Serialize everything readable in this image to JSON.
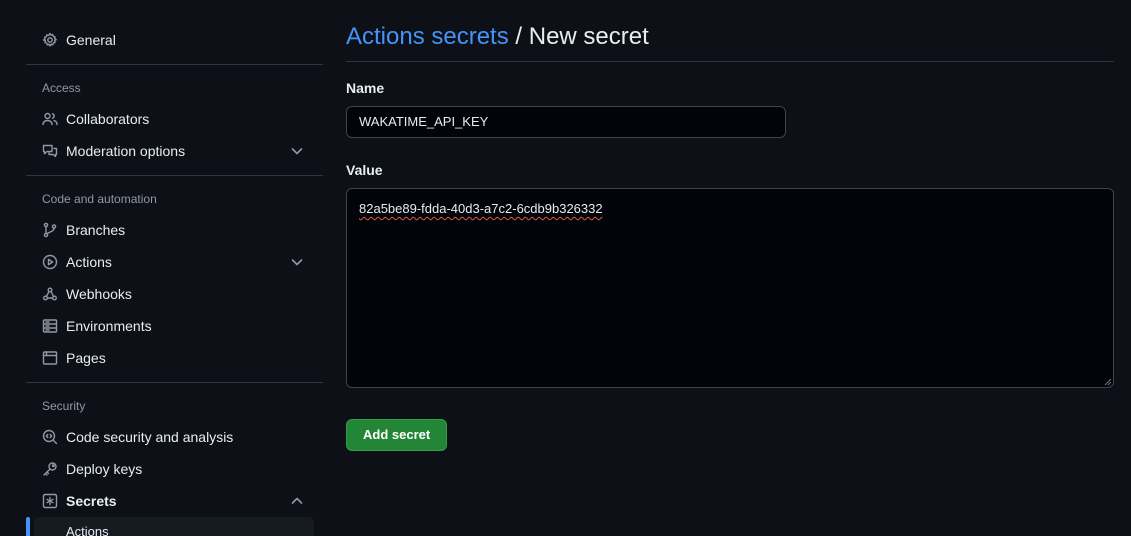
{
  "sidebar": {
    "general": {
      "label": "General",
      "icon": "gear-icon"
    },
    "access": {
      "heading": "Access",
      "items": [
        {
          "label": "Collaborators",
          "icon": "people-icon"
        },
        {
          "label": "Moderation options",
          "icon": "comment-discussion-icon",
          "expandable": true
        }
      ]
    },
    "code_automation": {
      "heading": "Code and automation",
      "items": [
        {
          "label": "Branches",
          "icon": "git-branch-icon"
        },
        {
          "label": "Actions",
          "icon": "play-icon",
          "expandable": true
        },
        {
          "label": "Webhooks",
          "icon": "webhook-icon"
        },
        {
          "label": "Environments",
          "icon": "server-icon"
        },
        {
          "label": "Pages",
          "icon": "browser-icon"
        }
      ]
    },
    "security": {
      "heading": "Security",
      "items": [
        {
          "label": "Code security and analysis",
          "icon": "codescan-icon"
        },
        {
          "label": "Deploy keys",
          "icon": "key-icon"
        },
        {
          "label": "Secrets",
          "icon": "asterisk-icon",
          "expanded": true
        }
      ],
      "secrets_sub": {
        "label": "Actions"
      }
    }
  },
  "main": {
    "breadcrumb_link": "Actions secrets",
    "breadcrumb_sep": " / ",
    "breadcrumb_current": "New secret",
    "name_label": "Name",
    "name_value": "WAKATIME_API_KEY",
    "value_label": "Value",
    "value_text": "82a5be89-fdda-40d3-a7c2-6cdb9b326332",
    "submit_label": "Add secret"
  },
  "colors": {
    "background": "#0d1117",
    "link": "#4493f8",
    "primary_button": "#238636",
    "active_marker": "#4493f8"
  }
}
